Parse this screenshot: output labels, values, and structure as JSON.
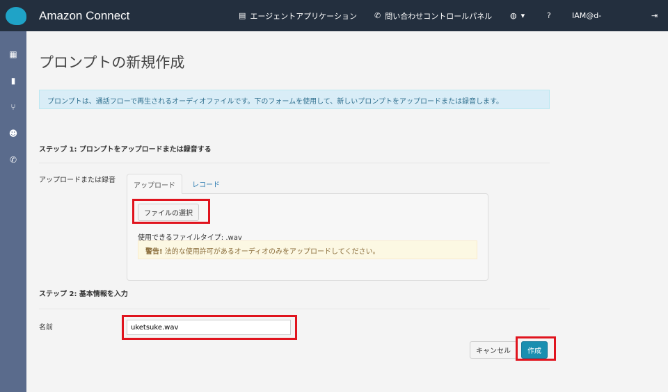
{
  "header": {
    "brand": "Amazon Connect",
    "agent_app": "エージェントアプリケーション",
    "ccp": "問い合わせコントロールパネル",
    "lang_caret": "▾",
    "user": "IAM@d-"
  },
  "page": {
    "title": "プロンプトの新規作成",
    "info": "プロンプトは、通話フローで再生されるオーディオファイルです。下のフォームを使用して、新しいプロンプトをアップロードまたは録音します。",
    "step1": "ステップ 1: プロンプトをアップロードまたは録音する",
    "upload_label": "アップロードまたは録音",
    "tabs": [
      "アップロード",
      "レコード"
    ],
    "choose_file": "ファイルの選択",
    "file_types": "使用できるファイルタイプ: .wav",
    "warning_strong": "警告!",
    "warning": "法的な使用許可があるオーディオのみをアップロードしてください。",
    "step2": "ステップ 2: 基本情報を入力",
    "name_label": "名前",
    "name_value": "uketsuke.wav",
    "cancel": "キャンセル",
    "create": "作成"
  }
}
